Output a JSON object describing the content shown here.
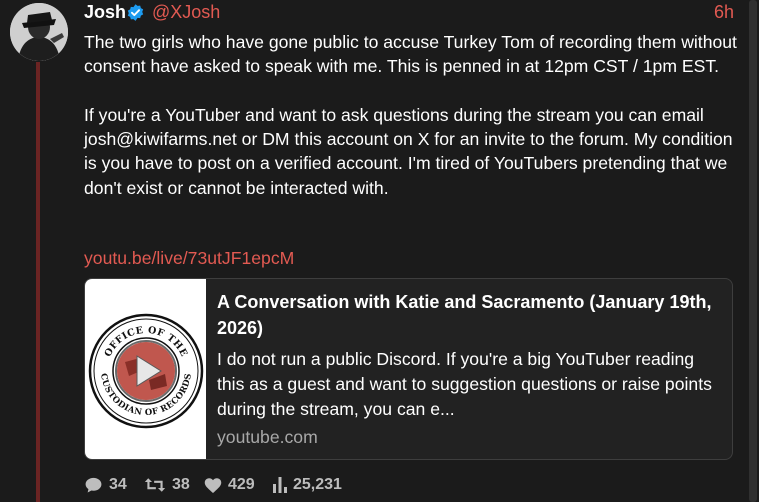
{
  "post": {
    "author": {
      "name": "Josh",
      "handle": "@XJosh",
      "verified": true,
      "avatar_icon": "avatar-image"
    },
    "time": "6h",
    "paragraphs": [
      "The two girls who have gone public to accuse Turkey Tom of recording them without consent have asked to speak with me. This is penned in at 12pm CST / 1pm EST.",
      "If you're a YouTuber and want to ask questions during the stream you can email josh@kiwifarms.net or DM this account on X for an invite to the forum. My condition is you have to post on a verified account. I'm tired of YouTubers pretending that we don't exist or cannot be interacted with."
    ],
    "link": "youtu.be/live/73utJF1epcM",
    "card": {
      "title": "A Conversation with Katie and Sacramento (January 19th, 2026)",
      "description": "I do not run a public Discord. If you're a big YouTuber reading this as a guest and want to suggestion questions or raise points during the stream, you can e...",
      "domain": "youtube.com",
      "thumbnail_text": "OFFICE OF THE CUSTODIAN OF RECORDS"
    },
    "stats": {
      "replies": "34",
      "reposts": "38",
      "likes": "429",
      "views": "25,231"
    }
  },
  "colors": {
    "background": "#1b1b1b",
    "accent": "#e25a52",
    "thread_line": "#6b2423",
    "verified": "#1d9bf0"
  }
}
